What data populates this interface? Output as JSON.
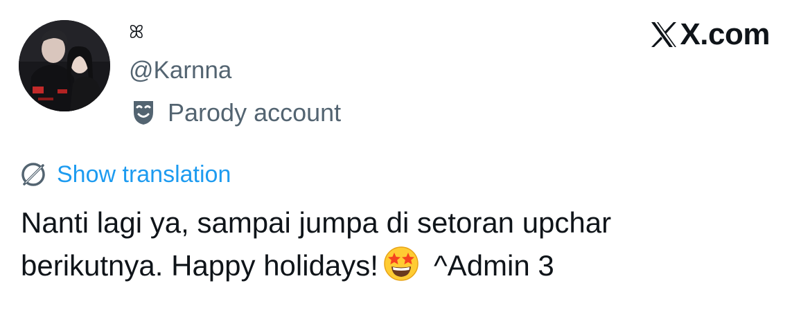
{
  "author": {
    "display_name": "ꕤ",
    "handle": "@Karnna",
    "parody_label": "Parody account",
    "avatar_icon": "avatar-photo"
  },
  "brand": {
    "text": "X.com",
    "icon": "x-logo-icon"
  },
  "translation": {
    "label": "Show translation",
    "icon": "translate-globe-icon",
    "color": "#1d9bf0"
  },
  "tweet": {
    "line1": "Nanti lagi ya, sampai jumpa di setoran upchar",
    "line2_prefix": "berikutnya. Happy holidays!",
    "emoji": "star-struck-emoji",
    "line2_suffix": "^Admin 3"
  },
  "colors": {
    "text_primary": "#0f1419",
    "text_secondary": "#536471",
    "link": "#1d9bf0"
  }
}
